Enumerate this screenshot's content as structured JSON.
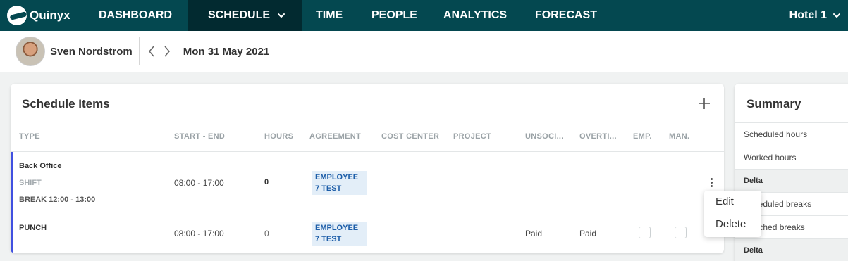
{
  "nav": {
    "logo_text": "Quinyx",
    "items": [
      {
        "label": "DASHBOARD"
      },
      {
        "label": "SCHEDULE"
      },
      {
        "label": "TIME"
      },
      {
        "label": "PEOPLE"
      },
      {
        "label": "ANALYTICS"
      },
      {
        "label": "FORECAST"
      }
    ],
    "unit_selector": "Hotel 1",
    "colors": {
      "bar": "#044850",
      "active": "#022a30"
    }
  },
  "subheader": {
    "employee_name": "Sven Nordstrom",
    "date": "Mon 31 May 2021"
  },
  "schedule": {
    "title": "Schedule Items",
    "columns": [
      "TYPE",
      "START - END",
      "HOURS",
      "AGREEMENT",
      "COST CENTER",
      "PROJECT",
      "UNSOCI...",
      "OVERTI...",
      "EMP.",
      "MAN."
    ],
    "rows": [
      {
        "title": "Back Office",
        "type": "SHIFT",
        "break": "BREAK 12:00 - 13:00",
        "start_end": "08:00 - 17:00",
        "hours": "0",
        "agreement_line1": "EMPLOYEE",
        "agreement_line2": "7 TEST"
      },
      {
        "type": "PUNCH",
        "start_end": "08:00 - 17:00",
        "hours": "0",
        "agreement_line1": "EMPLOYEE",
        "agreement_line2": "7 TEST",
        "unsocial": "Paid",
        "overtime": "Paid",
        "emp_checked": false,
        "man_checked": false
      }
    ],
    "accent_color": "#4050e0"
  },
  "context_menu": {
    "items": [
      "Edit",
      "Delete"
    ]
  },
  "summary": {
    "title": "Summary",
    "rows": [
      "Scheduled hours",
      "Worked hours",
      "Delta",
      "Scheduled breaks",
      "Punched breaks",
      "Delta"
    ]
  }
}
